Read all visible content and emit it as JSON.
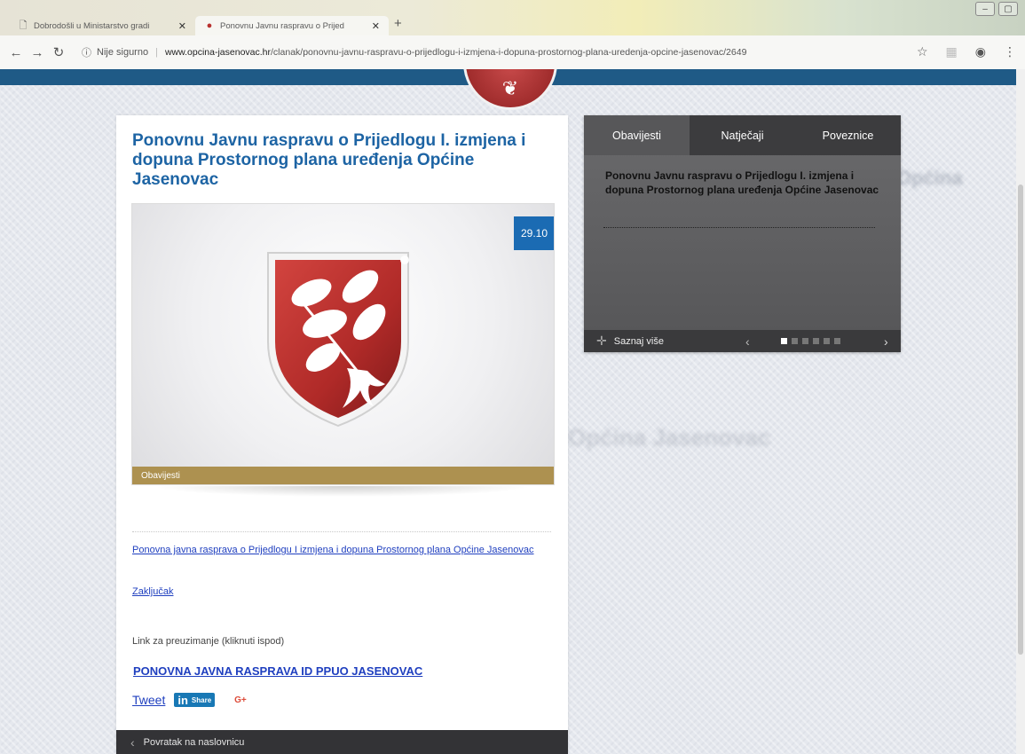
{
  "browser": {
    "tabs": [
      {
        "title": "Dobrodošli u Ministarstvo gradi",
        "icon": "page-icon"
      },
      {
        "title": "Ponovnu Javnu raspravu o Prijed",
        "icon": "crest-favicon"
      }
    ],
    "new_tab": "+",
    "security": "Nije sigurno",
    "url_host": "www.opcina-jasenovac.hr",
    "url_path": "/clanak/ponovnu-javnu-raspravu-o-prijedlogu-i-izmjena-i-dopuna-prostornog-plana-uredenja-opcine-jasenovac/2649"
  },
  "article": {
    "title": "Ponovnu Javnu raspravu o Prijedlogu I. izmjena i dopuna Prostornog plana uređenja Općine Jasenovac",
    "date": "29.10",
    "category": "Obavijesti",
    "links": [
      "Ponovna javna rasprava o Prijedlogu I izmjena i dopuna Prostornog plana Općine Jasenovac",
      "Zaključak"
    ],
    "download_label": "Link za preuzimanje  (kliknuti ispod)",
    "download_link": "PONOVNA JAVNA RASPRAVA ID PPUO JASENOVAC",
    "share": {
      "tweet": "Tweet",
      "linkedin_in": "in",
      "linkedin_label": "Share",
      "gplus": "G+"
    },
    "back": "Povratak na naslovnicu"
  },
  "widget": {
    "tabs": [
      "Obavijesti",
      "Natječaji",
      "Poveznice"
    ],
    "active_tab": 0,
    "text": "Ponovnu Javnu raspravu o Prijedlogu I. izmjena i dopuna Prostornog plana uređenja Općine Jasenovac",
    "more": "Saznaj više",
    "slides_total": 6,
    "slide_active": 1
  },
  "colors": {
    "brand_blue": "#1d64a4",
    "crest_red": "#b8312f",
    "category_gold": "#ad9150"
  }
}
